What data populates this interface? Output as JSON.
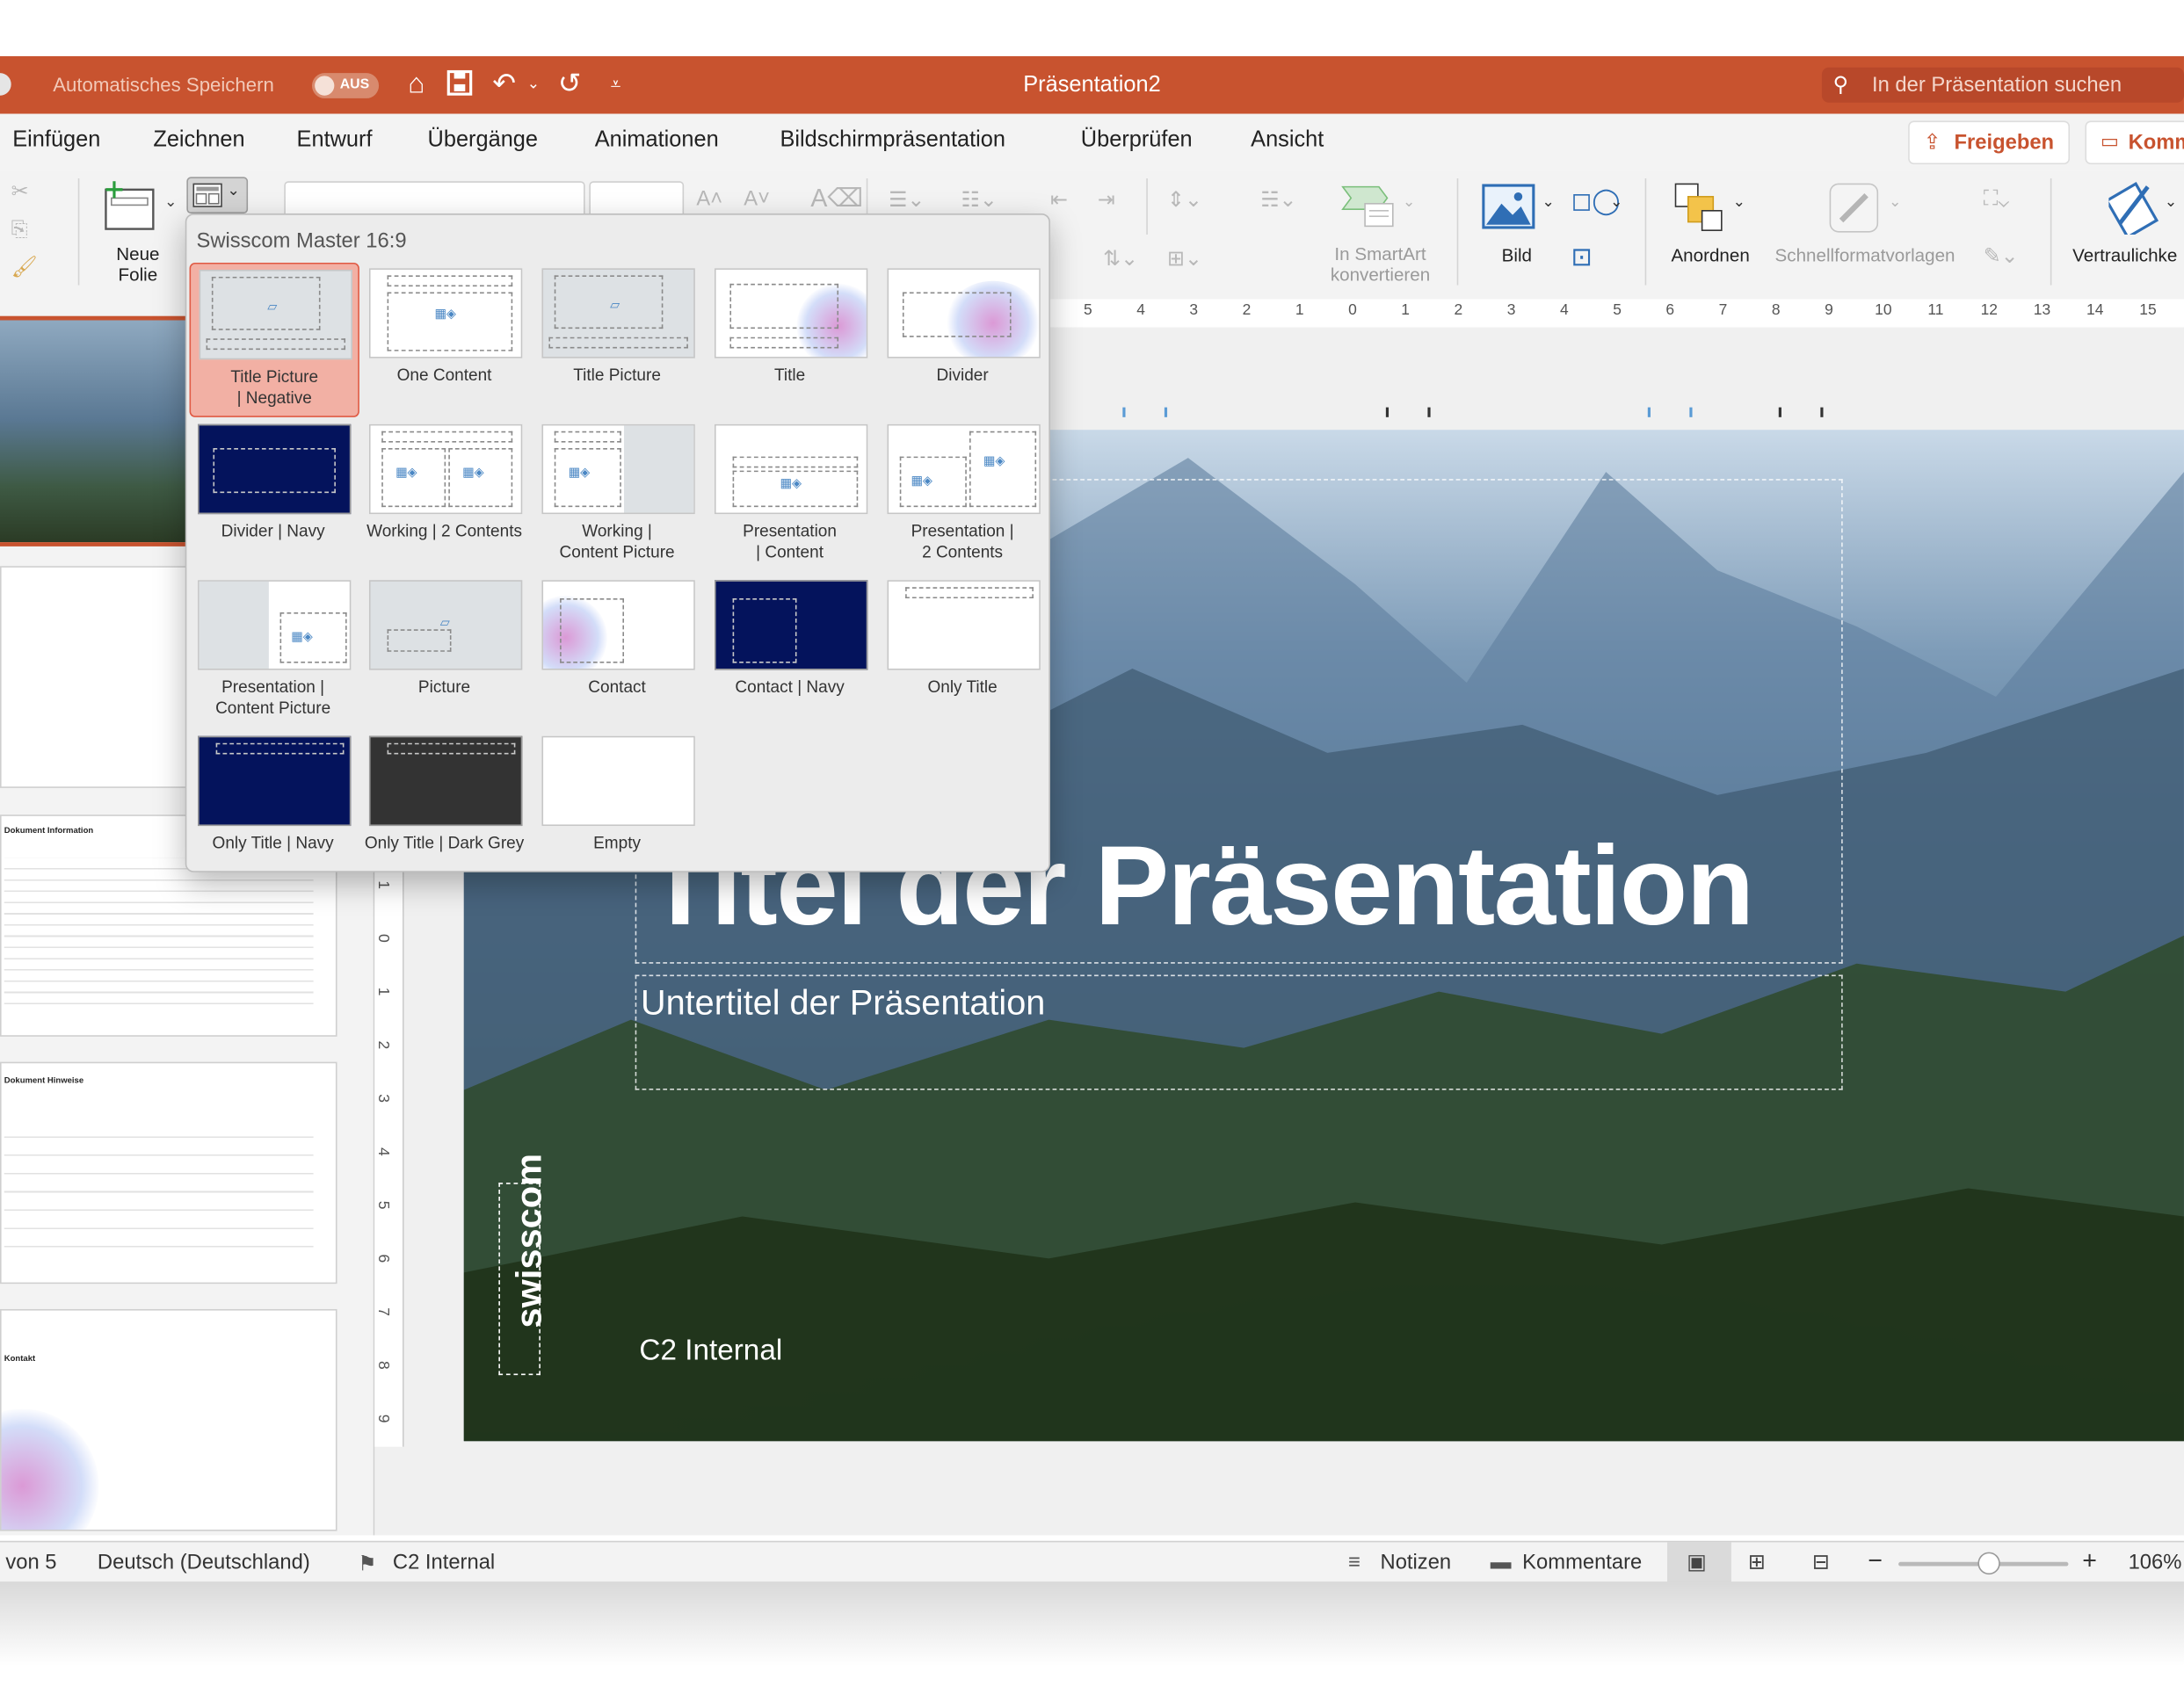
{
  "titlebar": {
    "autosave_label": "Automatisches Speichern",
    "autosave_state": "AUS",
    "document_title": "Präsentation2",
    "search_placeholder": "In der Präsentation suchen",
    "background_color": "#c8532f"
  },
  "menu": {
    "tabs": [
      "Einfügen",
      "Zeichnen",
      "Entwurf",
      "Übergänge",
      "Animationen",
      "Bildschirmpräsentation",
      "Überprüfen",
      "Ansicht"
    ],
    "share_label": "Freigeben",
    "comments_label": "Komm"
  },
  "ribbon": {
    "new_slide_label": "Neue\nFolie",
    "smartart_label": "In SmartArt\nkonvertieren",
    "picture_label": "Bild",
    "arrange_label": "Anordnen",
    "quickstyles_label": "Schnellformatvorlagen",
    "sensitivity_label": "Vertraulichke"
  },
  "ruler": {
    "labels": [
      "5",
      "4",
      "3",
      "2",
      "1",
      "0",
      "1",
      "2",
      "3",
      "4",
      "5",
      "6",
      "7",
      "8",
      "9",
      "10",
      "11",
      "12",
      "13",
      "14",
      "15"
    ],
    "vertical_labels": [
      "1",
      "0",
      "1",
      "2",
      "3",
      "4",
      "5",
      "6",
      "7",
      "8",
      "9"
    ]
  },
  "layout_gallery": {
    "header": "Swisscom Master 16:9",
    "selected": "Title Picture | Negative",
    "items": [
      {
        "line1": "Title Picture",
        "line2": "| Negative",
        "style": "grey"
      },
      {
        "line1": "One Content",
        "line2": "",
        "style": "white"
      },
      {
        "line1": "Title Picture",
        "line2": "",
        "style": "grey"
      },
      {
        "line1": "Title",
        "line2": "",
        "style": "white"
      },
      {
        "line1": "Divider",
        "line2": "",
        "style": "white"
      },
      {
        "line1": "Divider | Navy",
        "line2": "",
        "style": "navy"
      },
      {
        "line1": "Working | 2 Contents",
        "line2": "",
        "style": "white"
      },
      {
        "line1": "Working |",
        "line2": "Content Picture",
        "style": "white"
      },
      {
        "line1": "Presentation",
        "line2": "| Content",
        "style": "white"
      },
      {
        "line1": "Presentation |",
        "line2": "2 Contents",
        "style": "white"
      },
      {
        "line1": "Presentation |",
        "line2": "Content Picture",
        "style": "white"
      },
      {
        "line1": "Picture",
        "line2": "",
        "style": "grey"
      },
      {
        "line1": "Contact",
        "line2": "",
        "style": "white"
      },
      {
        "line1": "Contact | Navy",
        "line2": "",
        "style": "navy"
      },
      {
        "line1": "Only Title",
        "line2": "",
        "style": "white"
      },
      {
        "line1": "Only Title | Navy",
        "line2": "",
        "style": "navy"
      },
      {
        "line1": "Only Title | Dark Grey",
        "line2": "",
        "style": "dark"
      },
      {
        "line1": "Empty",
        "line2": "",
        "style": "white"
      }
    ]
  },
  "slide": {
    "title": "Titel der Präsentation",
    "subtitle": "Untertitel der Präsentation",
    "classification": "C2 Internal",
    "logo": "swisscom"
  },
  "thumbnails": {
    "doc_info": "Dokument Information",
    "doc_notes": "Dokument Hinweise",
    "contact": "Kontakt"
  },
  "statusbar": {
    "slide_counter": "von 5",
    "language": "Deutsch (Deutschland)",
    "sensitivity": "C2 Internal",
    "notes": "Notizen",
    "comments": "Kommentare",
    "zoom": "106%",
    "zoom_fraction": 0.53
  }
}
